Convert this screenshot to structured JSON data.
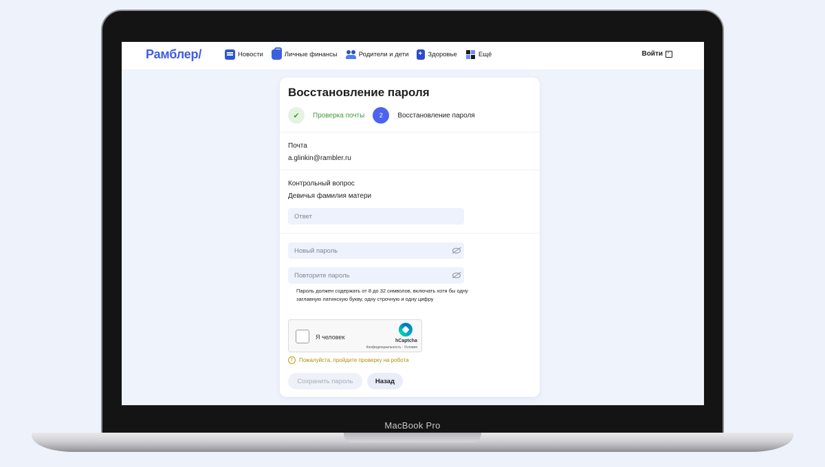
{
  "device": {
    "label": "MacBook Pro"
  },
  "header": {
    "logo": "Рамблер/",
    "nav": [
      {
        "label": "Новости",
        "icon": "news-icon"
      },
      {
        "label": "Личные финансы",
        "icon": "wallet-icon"
      },
      {
        "label": "Родители и дети",
        "icon": "family-icon"
      },
      {
        "label": "Здоровье",
        "icon": "health-icon"
      },
      {
        "label": "Ещё",
        "icon": "grid-icon"
      }
    ],
    "login_label": "Войти"
  },
  "card": {
    "title": "Восстановление пароля",
    "steps": [
      {
        "number": "",
        "label": "Проверка почты",
        "state": "done"
      },
      {
        "number": "2",
        "label": "Восстановление пароля",
        "state": "current"
      }
    ],
    "email_label": "Почта",
    "email_value": "a.glinkin@rambler.ru",
    "question_label": "Контрольный вопрос",
    "question_value": "Девичья фамилия матери",
    "answer_placeholder": "Ответ",
    "new_password_placeholder": "Новый пароль",
    "repeat_password_placeholder": "Повторите пароль",
    "password_hint": "Пароль должен содержать от 8 до 32 символов, включать хотя бы одну заглавную латинскую букву, одну строчную и одну цифру",
    "captcha": {
      "checkbox_label": "Я человек",
      "brand": "hCaptcha",
      "links": "Конфиденциальность - Условия"
    },
    "warning": "Пожалуйста, пройдите проверку на робота",
    "save_label": "Сохранить пароль",
    "back_label": "Назад"
  },
  "colors": {
    "brand": "#3e5be8",
    "step_done": "#3f9a3a",
    "step_current": "#4c63f1",
    "warning": "#b88a08"
  }
}
